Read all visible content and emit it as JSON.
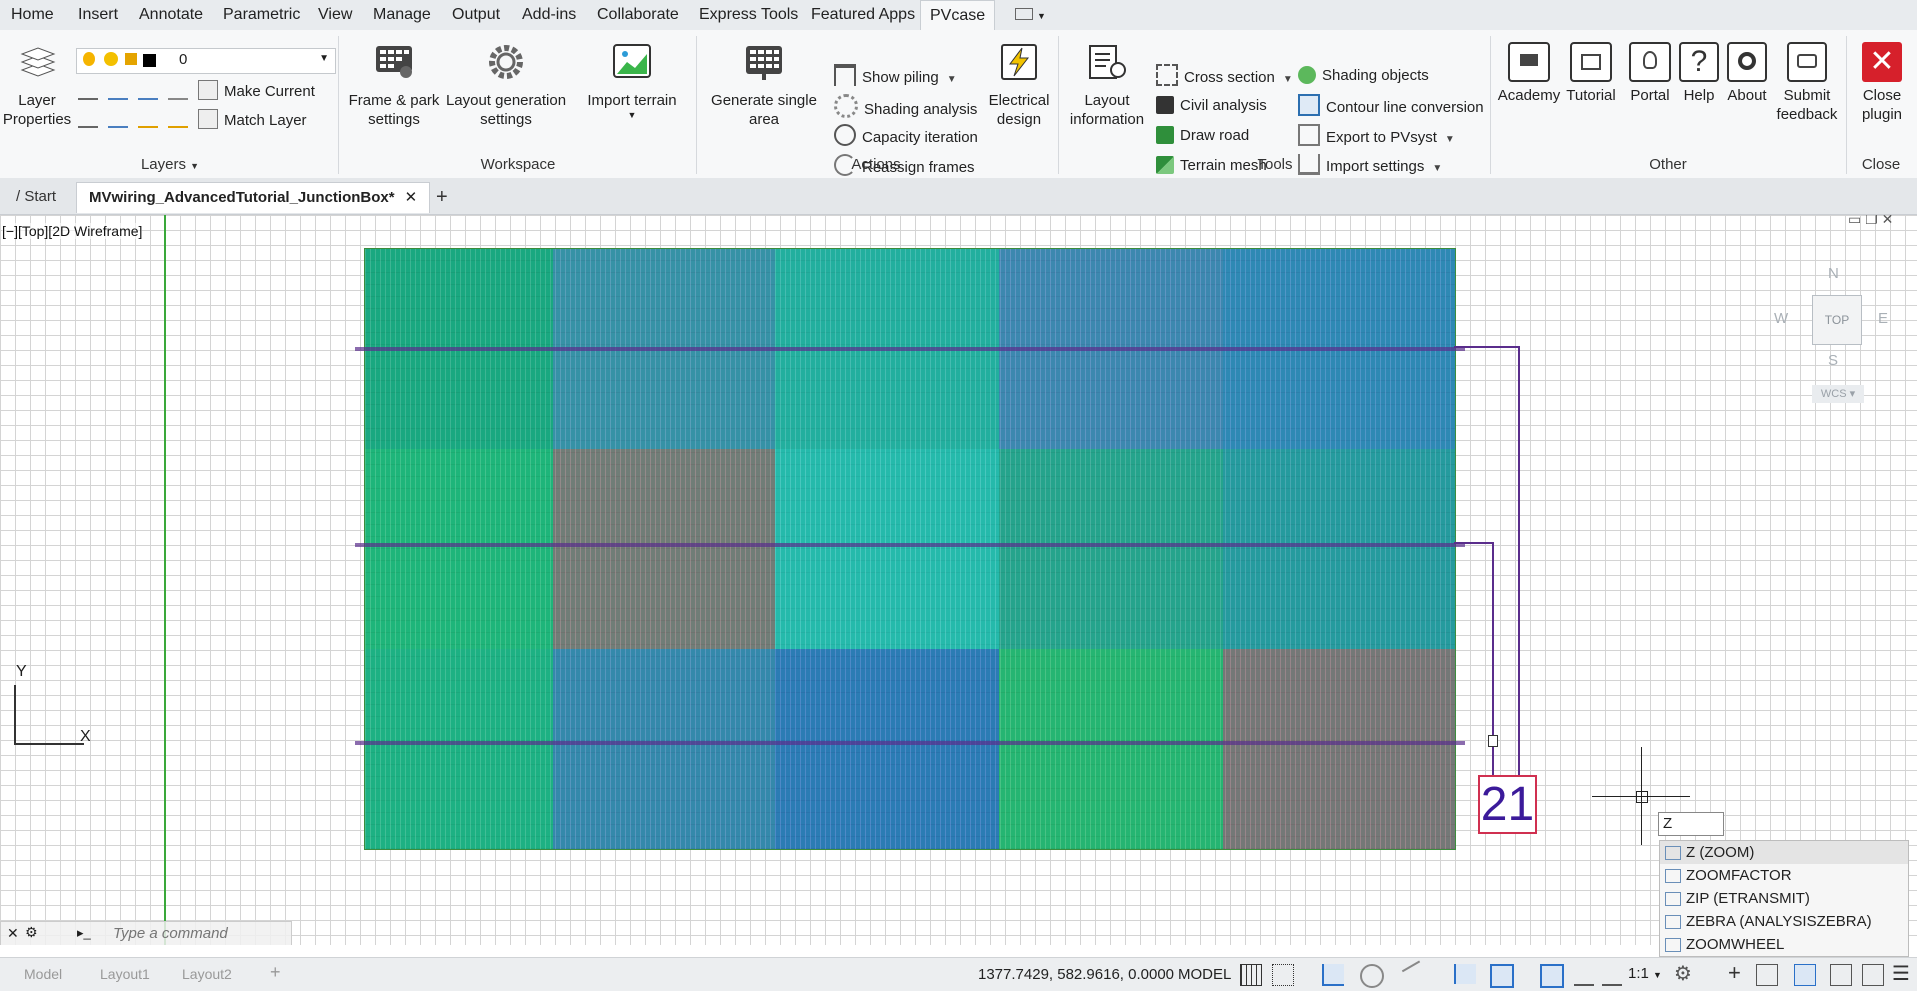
{
  "menu_tabs": [
    "Home",
    "Insert",
    "Annotate",
    "Parametric",
    "View",
    "Manage",
    "Output",
    "Add-ins",
    "Collaborate",
    "Express Tools",
    "Featured Apps",
    "PVcase"
  ],
  "active_tab": "PVcase",
  "ribbon": {
    "layers": {
      "layer_properties": "Layer\nProperties",
      "current_layer": "0",
      "make_current": "Make Current",
      "match_layer": "Match Layer",
      "title": "Layers"
    },
    "workspace": {
      "frame_park": "Frame & park\nsettings",
      "layout_generation": "Layout generation\nsettings",
      "import_terrain": "Import terrain",
      "title": "Workspace"
    },
    "actions": {
      "generate_single_area": "Generate single\narea",
      "show_piling": "Show piling",
      "shading_analysis": "Shading analysis",
      "capacity_iteration": "Capacity iteration",
      "reassign_frames": "Reassign frames",
      "electrical_design": "Electrical\ndesign",
      "title": "Actions"
    },
    "tools": {
      "layout_information": "Layout\ninformation",
      "cross_section": "Cross section",
      "civil_analysis": "Civil analysis",
      "draw_road": "Draw road",
      "terrain_mesh": "Terrain mesh",
      "shading_objects": "Shading objects",
      "contour_line_conversion": "Contour line conversion",
      "export_to_pvsyst": "Export to PVsyst",
      "import_settings": "Import settings",
      "title": "Tools"
    },
    "other": {
      "academy": "Academy",
      "tutorial": "Tutorial",
      "portal": "Portal",
      "help": "Help",
      "about": "About",
      "submit_feedback": "Submit\nfeedback",
      "title": "Other"
    },
    "close": {
      "close_plugin": "Close\nplugin",
      "title": "Close"
    }
  },
  "doc_tabs": {
    "start": "Start",
    "active": "MVwiring_AdvancedTutorial_JunctionBox*"
  },
  "viewport": {
    "view_label": "[−][Top][2D Wireframe]",
    "junction_label": "21",
    "viewcube": {
      "n": "N",
      "s": "S",
      "e": "E",
      "w": "W",
      "face": "TOP",
      "wcs": "WCS"
    },
    "ucs_x": "X",
    "ucs_y": "Y"
  },
  "command": {
    "input": "Z",
    "placeholder": "Type a command",
    "suggestions": [
      "Z (ZOOM)",
      "ZOOMFACTOR",
      "ZIP (ETRANSMIT)",
      "ZEBRA (ANALYSISZEBRA)",
      "ZOOMWHEEL"
    ]
  },
  "status": {
    "coords": "1377.7429, 582.9616, 0.0000",
    "model": "MODEL",
    "scale": "1:1",
    "layout_tabs": [
      "Model",
      "Layout1",
      "Layout2"
    ]
  },
  "colors": {
    "accent": "#1e6fd0",
    "close_red": "#d6202b",
    "route": "#5a2d8c",
    "panel_green": "#19a888"
  }
}
